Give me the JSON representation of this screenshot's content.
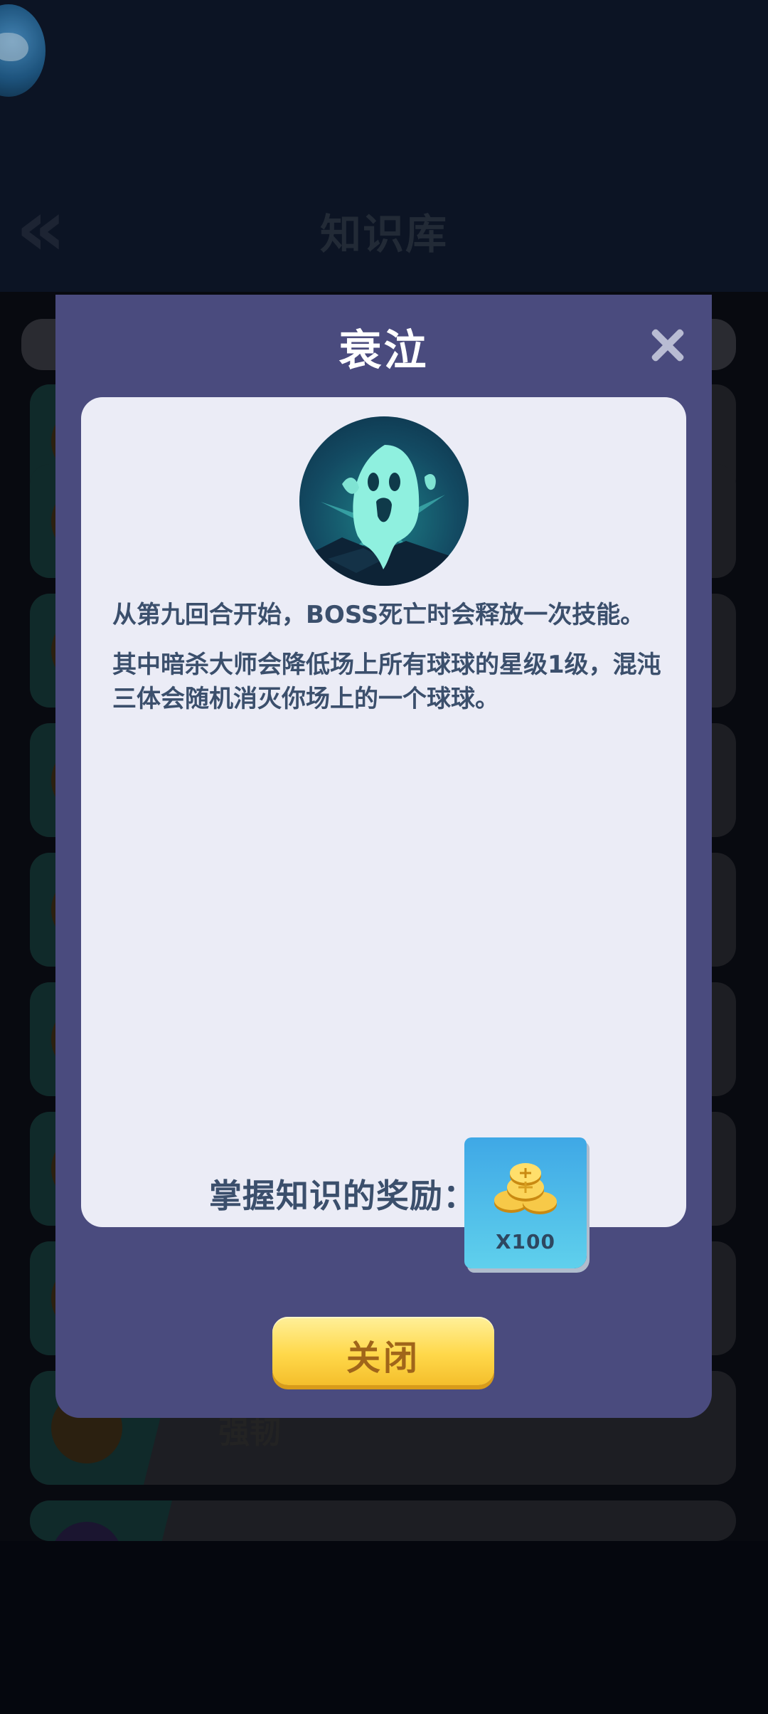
{
  "background": {
    "page_title": "知识库",
    "list_items": [
      {
        "name": ""
      },
      {
        "name": ""
      },
      {
        "name": ""
      },
      {
        "name": ""
      },
      {
        "name": ""
      },
      {
        "name": ""
      },
      {
        "name": ""
      },
      {
        "name": ""
      },
      {
        "name": "强韧"
      },
      {
        "name": "…"
      }
    ]
  },
  "modal": {
    "title": "衰泣",
    "icon": "ghost-icon",
    "description": [
      "从第九回合开始，BOSS死亡时会释放一次技能。",
      "其中暗杀大师会降低场上所有球球的星级1级，混沌三体会随机消灭你场上的一个球球。"
    ],
    "reward_label": "掌握知识的奖励：",
    "reward_item": {
      "icon": "gold-coins-icon",
      "quantity": "X100"
    },
    "close_button": "关闭"
  },
  "colors": {
    "modal_bg": "#4a4b7e",
    "panel_bg": "#ebecf6",
    "text": "#3b4f6c",
    "button_yellow": "#ffd84a",
    "reward_blue": "#3fa8e6"
  }
}
